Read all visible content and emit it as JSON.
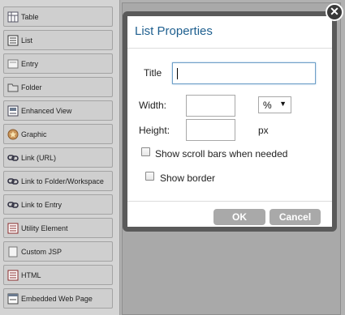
{
  "palette": {
    "items": [
      {
        "label": "Table",
        "icon": "table-icon"
      },
      {
        "label": "List",
        "icon": "list-icon"
      },
      {
        "label": "Entry",
        "icon": "entry-icon"
      },
      {
        "label": "Folder",
        "icon": "folder-icon"
      },
      {
        "label": "Enhanced View",
        "icon": "enhanced-view-icon"
      },
      {
        "label": "Graphic",
        "icon": "graphic-icon"
      },
      {
        "label": "Link (URL)",
        "icon": "link-icon"
      },
      {
        "label": "Link to Folder/Workspace",
        "icon": "link-icon"
      },
      {
        "label": "Link to Entry",
        "icon": "link-icon"
      },
      {
        "label": "Utility Element",
        "icon": "utility-icon"
      },
      {
        "label": "Custom JSP",
        "icon": "custom-jsp-icon"
      },
      {
        "label": "HTML",
        "icon": "html-icon"
      },
      {
        "label": "Embedded Web Page",
        "icon": "web-page-icon"
      }
    ]
  },
  "dialog": {
    "title": "List Properties",
    "title_label": "Title",
    "title_value": "",
    "width_label": "Width:",
    "width_value": "",
    "width_unit": "%",
    "height_label": "Height:",
    "height_value": "",
    "height_unit": "px",
    "scrollbars_label": "Show scroll bars when needed",
    "scrollbars_checked": false,
    "border_label": "Show border",
    "border_checked": false,
    "ok_label": "OK",
    "cancel_label": "Cancel",
    "close_glyph": "✕"
  },
  "colors": {
    "title_blue": "#1e5f8f",
    "button_grey": "#a9a9a9",
    "dialog_frame": "#5a5a5a"
  }
}
